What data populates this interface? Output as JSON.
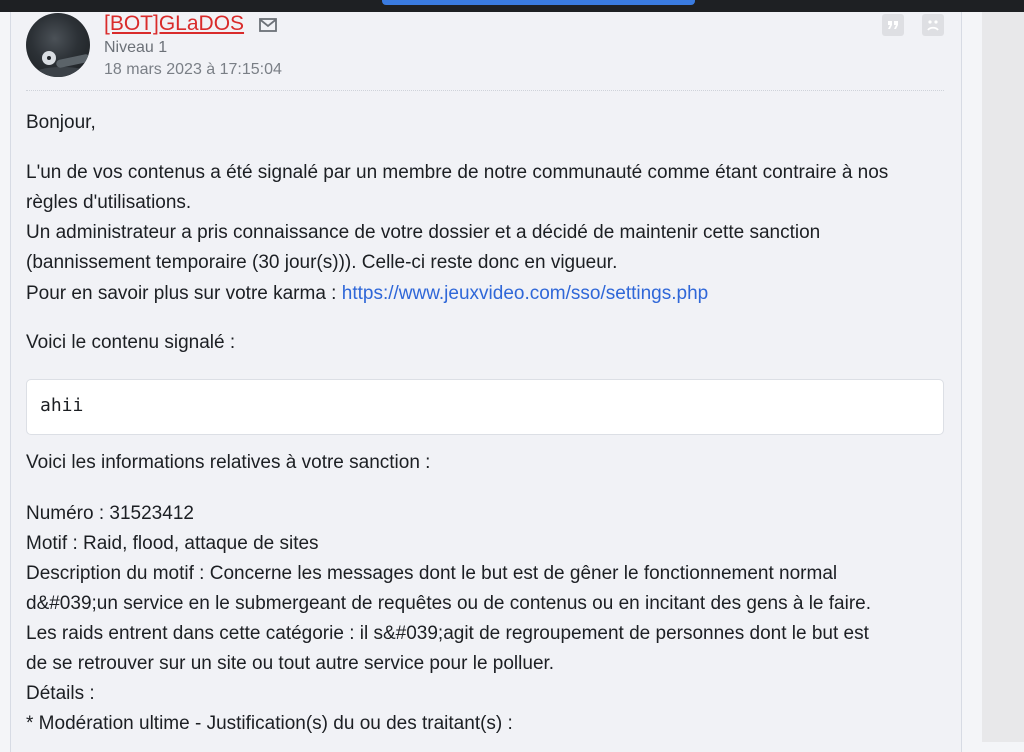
{
  "post": {
    "author": {
      "name": "[BOT]GLaDOS",
      "level": "Niveau 1",
      "date": "18 mars 2023 à 17:15:04"
    },
    "icons": {
      "mail": "mail-icon",
      "quote": "quote-icon",
      "alert": "sad-face-report-icon"
    },
    "colors": {
      "author": "#d92b2b",
      "link": "#2f67d8",
      "accent": "#3a7be0"
    },
    "body": {
      "greeting": "Bonjour,",
      "p1_line1": "L'un de vos contenus a été signalé par un membre de notre communauté comme étant contraire à nos",
      "p1_line2": "règles d'utilisations.",
      "p1_line3": "Un administrateur a pris connaissance de votre dossier et a décidé de maintenir cette sanction",
      "p1_line4": "(bannissement temporaire (30 jour(s))). Celle-ci reste donc en vigueur.",
      "karma_prefix": "Pour en savoir plus sur votre karma : ",
      "karma_link": "https://www.jeuxvideo.com/sso/settings.php",
      "reported_heading": "Voici le contenu signalé :",
      "reported_content": "ahii",
      "info_heading": "Voici les informations relatives à votre sanction :",
      "numero": "Numéro : 31523412",
      "motif": "Motif : Raid, flood, attaque de sites",
      "desc_line1": "Description du motif : Concerne les messages dont le but est de gêner le fonctionnement normal",
      "desc_line2": "d&#039;un service en le submergeant de requêtes ou de contenus ou en incitant des gens à le faire.",
      "desc_line3": "Les raids entrent dans cette catégorie : il s&#039;agit de regroupement de personnes dont le but est",
      "desc_line4": "de se retrouver sur un site ou tout autre service pour le polluer.",
      "details": "Détails :",
      "moderation": "* Modération ultime - Justification(s) du ou des traitant(s) :"
    }
  }
}
